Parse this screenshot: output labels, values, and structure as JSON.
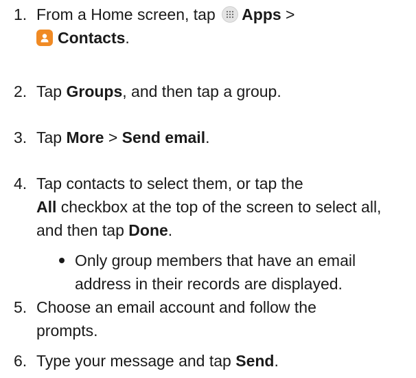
{
  "steps": [
    {
      "number": "1.",
      "prefix": "From a Home screen, tap",
      "apps_icon": "apps-grid-icon",
      "apps_label": "Apps",
      "sep": ">",
      "contacts_icon": "contacts-icon",
      "contacts_label": "Contacts",
      "suffix": "."
    },
    {
      "number": "2.",
      "prefix": "Tap",
      "bold1": "Groups",
      "suffix": ", and then tap a group."
    },
    {
      "number": "3.",
      "prefix": "Tap",
      "bold1": "More",
      "sep": ">",
      "bold2": "Send email",
      "suffix": "."
    },
    {
      "number": "4.",
      "prefix": "Tap contacts to select them, or tap the",
      "bold1": "All",
      "middle": "checkbox at the top of the screen to select all, and then tap",
      "bold2": "Done",
      "suffix": ".",
      "bullet": "Only group members that have an email address in their records are displayed."
    },
    {
      "number": "5.",
      "text": "Choose an email account and follow the prompts."
    },
    {
      "number": "6.",
      "prefix": "Type your message and tap",
      "bold1": "Send",
      "suffix": "."
    }
  ],
  "colors": {
    "text": "#1a1a1a",
    "contacts_icon_bg": "#f08a24",
    "apps_icon_bg": "#e4e4e4"
  }
}
